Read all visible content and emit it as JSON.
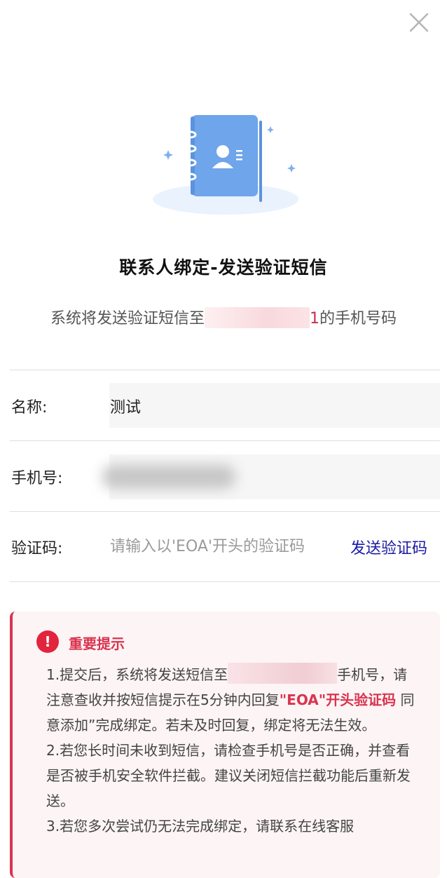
{
  "dialog": {
    "close_icon": "close-icon",
    "illustration_icon": "contact-book-icon",
    "title": "联系人绑定-发送验证短信",
    "subtitle_prefix": "系统将发送验证短信至",
    "subtitle_tail": "1",
    "subtitle_suffix": "的手机号码"
  },
  "form": {
    "name_label": "名称:",
    "name_value": "测试",
    "phone_label": "手机号:",
    "code_label": "验证码:",
    "code_placeholder": "请输入以'EOA'开头的验证码",
    "send_code_label": "发送验证码"
  },
  "notice": {
    "icon_text": "!",
    "title": "重要提示",
    "p1_a": "1.提交后，系统将发送短信至",
    "p1_b": "手机号，请注意查收并按短信提示在5分钟内回复",
    "p1_hl": "\"EOA\"开头验证码",
    "p1_c": " 同意添加”完成绑定。若未及时回复，绑定将无法生效。",
    "p2": "2.若您长时间未收到短信，请检查手机号是否正确，并查看是否被手机安全软件拦截。建议关闭短信拦截功能后重新发送。",
    "p3": "3.若您多次尝试仍无法完成绑定，请联系在线客服"
  },
  "colors": {
    "accent_red": "#d9344f",
    "link_blue": "#1a1aa6",
    "illustration_blue": "#6fa5ea"
  }
}
